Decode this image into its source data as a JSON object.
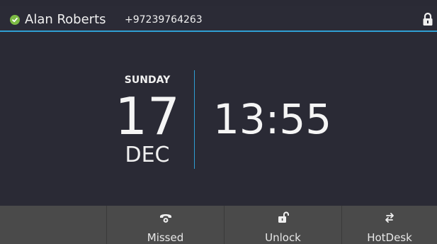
{
  "header": {
    "status": "available",
    "status_color": "#7dbb45",
    "user_name": "Alan Roberts",
    "phone_number": "+97239764263",
    "lock_icon": "lock-icon",
    "accent_color": "#2f9fd3"
  },
  "date": {
    "day_name": "SUNDAY",
    "day_number": "17",
    "month": "DEC"
  },
  "clock": {
    "time": "13:55"
  },
  "softkeys": [
    {
      "label": "",
      "icon": ""
    },
    {
      "label": "Missed",
      "icon": "missed-call-icon"
    },
    {
      "label": "Unlock",
      "icon": "unlock-icon"
    },
    {
      "label": "HotDesk",
      "icon": "hotdesk-icon"
    }
  ]
}
